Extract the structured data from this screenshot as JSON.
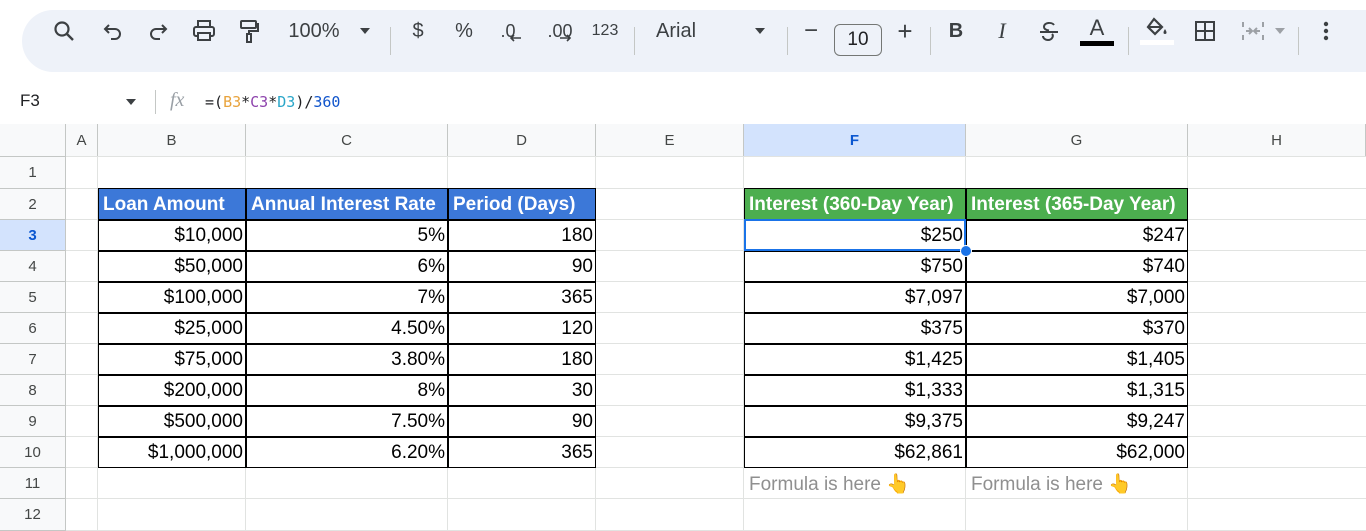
{
  "toolbar": {
    "zoom": "100%",
    "currency": "$",
    "percent": "%",
    "decrease_decimals": ".0",
    "increase_decimals": ".00",
    "more_formats": "123",
    "font_name": "Arial",
    "font_size": "10",
    "minus": "−",
    "plus": "+",
    "bold": "B",
    "italic": "I",
    "text_color_letter": "A"
  },
  "formula_bar": {
    "cell_ref": "F3",
    "fx": "fx",
    "formula_parts": [
      "=(",
      "B3",
      "*",
      "C3",
      "*",
      "D3",
      ")/",
      "360"
    ],
    "colors": {
      "B3": "#e8a33d",
      "C3": "#8e44ad",
      "D3": "#2aa6c9",
      "number": "#1155cc"
    }
  },
  "column_headers": [
    "A",
    "B",
    "C",
    "D",
    "E",
    "F",
    "G",
    "H"
  ],
  "row_numbers": [
    "1",
    "2",
    "3",
    "4",
    "5",
    "6",
    "7",
    "8",
    "9",
    "10",
    "11",
    "12"
  ],
  "selected": {
    "column": "F",
    "row": "3"
  },
  "loan_table": {
    "headers": [
      "Loan Amount",
      "Annual Interest Rate",
      "Period (Days)"
    ],
    "rows": [
      [
        "$10,000",
        "5%",
        "180"
      ],
      [
        "$50,000",
        "6%",
        "90"
      ],
      [
        "$100,000",
        "7%",
        "365"
      ],
      [
        "$25,000",
        "4.50%",
        "120"
      ],
      [
        "$75,000",
        "3.80%",
        "180"
      ],
      [
        "$200,000",
        "8%",
        "30"
      ],
      [
        "$500,000",
        "7.50%",
        "90"
      ],
      [
        "$1,000,000",
        "6.20%",
        "365"
      ]
    ]
  },
  "interest_table": {
    "headers": [
      "Interest (360-Day Year)",
      "Interest (365-Day Year)"
    ],
    "rows": [
      [
        "$250",
        "$247"
      ],
      [
        "$750",
        "$740"
      ],
      [
        "$7,097",
        "$7,000"
      ],
      [
        "$375",
        "$370"
      ],
      [
        "$1,425",
        "$1,405"
      ],
      [
        "$1,333",
        "$1,315"
      ],
      [
        "$9,375",
        "$9,247"
      ],
      [
        "$62,861",
        "$62,000"
      ]
    ]
  },
  "notes": [
    "Formula is here 👆",
    "Formula is here 👆"
  ],
  "colors": {
    "blue_header": "#3c78d8",
    "green_header": "#4cae4f",
    "selection": "#1a73e8"
  }
}
